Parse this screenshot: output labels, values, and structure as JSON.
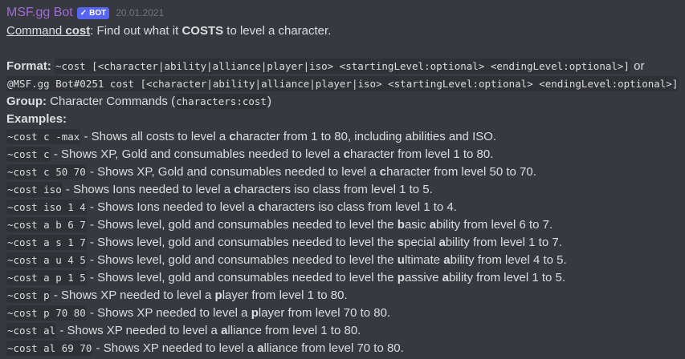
{
  "author": {
    "name": "MSF.gg Bot",
    "badge": "BOT",
    "timestamp": "20.01.2021"
  },
  "intro": {
    "prefix": "Command ",
    "command": "cost",
    "colon": ":",
    "text1": " Find out what it ",
    "emphasis": "COSTS",
    "text2": " to level a character."
  },
  "format": {
    "label": "Format:",
    "syntax1": "~cost [<character|ability|alliance|player|iso> <startingLevel:optional> <endingLevel:optional>]",
    "or": " or",
    "syntax2": "@MSF.gg Bot#0251 cost [<character|ability|alliance|player|iso> <startingLevel:optional> <endingLevel:optional>]"
  },
  "group": {
    "label": "Group:",
    "text": " Character Commands ",
    "paren_open": "(",
    "code": "characters:cost",
    "paren_close": ")"
  },
  "examples_label": "Examples:",
  "examples": [
    {
      "code": "~cost c -max",
      "parts": [
        " - Shows all costs to level a ",
        "c",
        "haracter from 1 to 80, including abilities and ISO."
      ]
    },
    {
      "code": "~cost c",
      "parts": [
        " - Shows XP, Gold and consumables needed to level a ",
        "c",
        "haracter from level 1 to 80."
      ]
    },
    {
      "code": "~cost c 50 70",
      "parts": [
        " - Shows XP, Gold and consumables needed to level a ",
        "c",
        "haracter from level 50 to 70."
      ]
    },
    {
      "code": "~cost iso",
      "parts": [
        " - Shows Ions needed to level a ",
        "c",
        "haracters iso class from level 1 to 5."
      ]
    },
    {
      "code": "~cost iso 1 4",
      "parts": [
        " - Shows Ions needed to level a ",
        "c",
        "haracters iso class from level 1 to 4."
      ]
    },
    {
      "code": "~cost a b 6 7",
      "parts": [
        " - Shows level, gold and consumables needed to level the ",
        "b",
        "asic ",
        "a",
        "bility from level 6 to 7."
      ]
    },
    {
      "code": "~cost a s 1 7",
      "parts": [
        " - Shows level, gold and consumables needed to level the ",
        "s",
        "pecial ",
        "a",
        "bility from level 1 to 7."
      ]
    },
    {
      "code": "~cost a u 4 5",
      "parts": [
        " - Shows level, gold and consumables needed to level the ",
        "u",
        "ltimate ",
        "a",
        "bility from level 4 to 5."
      ]
    },
    {
      "code": "~cost a p 1 5",
      "parts": [
        " - Shows level, gold and consumables needed to level the ",
        "p",
        "assive ",
        "a",
        "bility from level 1 to 5."
      ]
    },
    {
      "code": "~cost p",
      "parts": [
        " - Shows XP needed to level a ",
        "p",
        "layer from level 1 to 80."
      ]
    },
    {
      "code": "~cost p 70 80",
      "parts": [
        " - Shows XP needed to level a ",
        "p",
        "layer from level 70 to 80."
      ]
    },
    {
      "code": "~cost al",
      "parts": [
        " - Shows XP needed to level a ",
        "a",
        "lliance from level 1 to 80."
      ]
    },
    {
      "code": "~cost al 69 70",
      "parts": [
        " - Shows XP needed to level a ",
        "a",
        "lliance from level 70 to 80."
      ]
    }
  ],
  "colors": {
    "background": "#36393f",
    "text": "#dcddde",
    "author": "#a16bd4",
    "badge": "#5865f2",
    "timestamp": "#72767d",
    "code_bg": "#2f3136"
  },
  "icons": {
    "verified": "check-icon"
  }
}
